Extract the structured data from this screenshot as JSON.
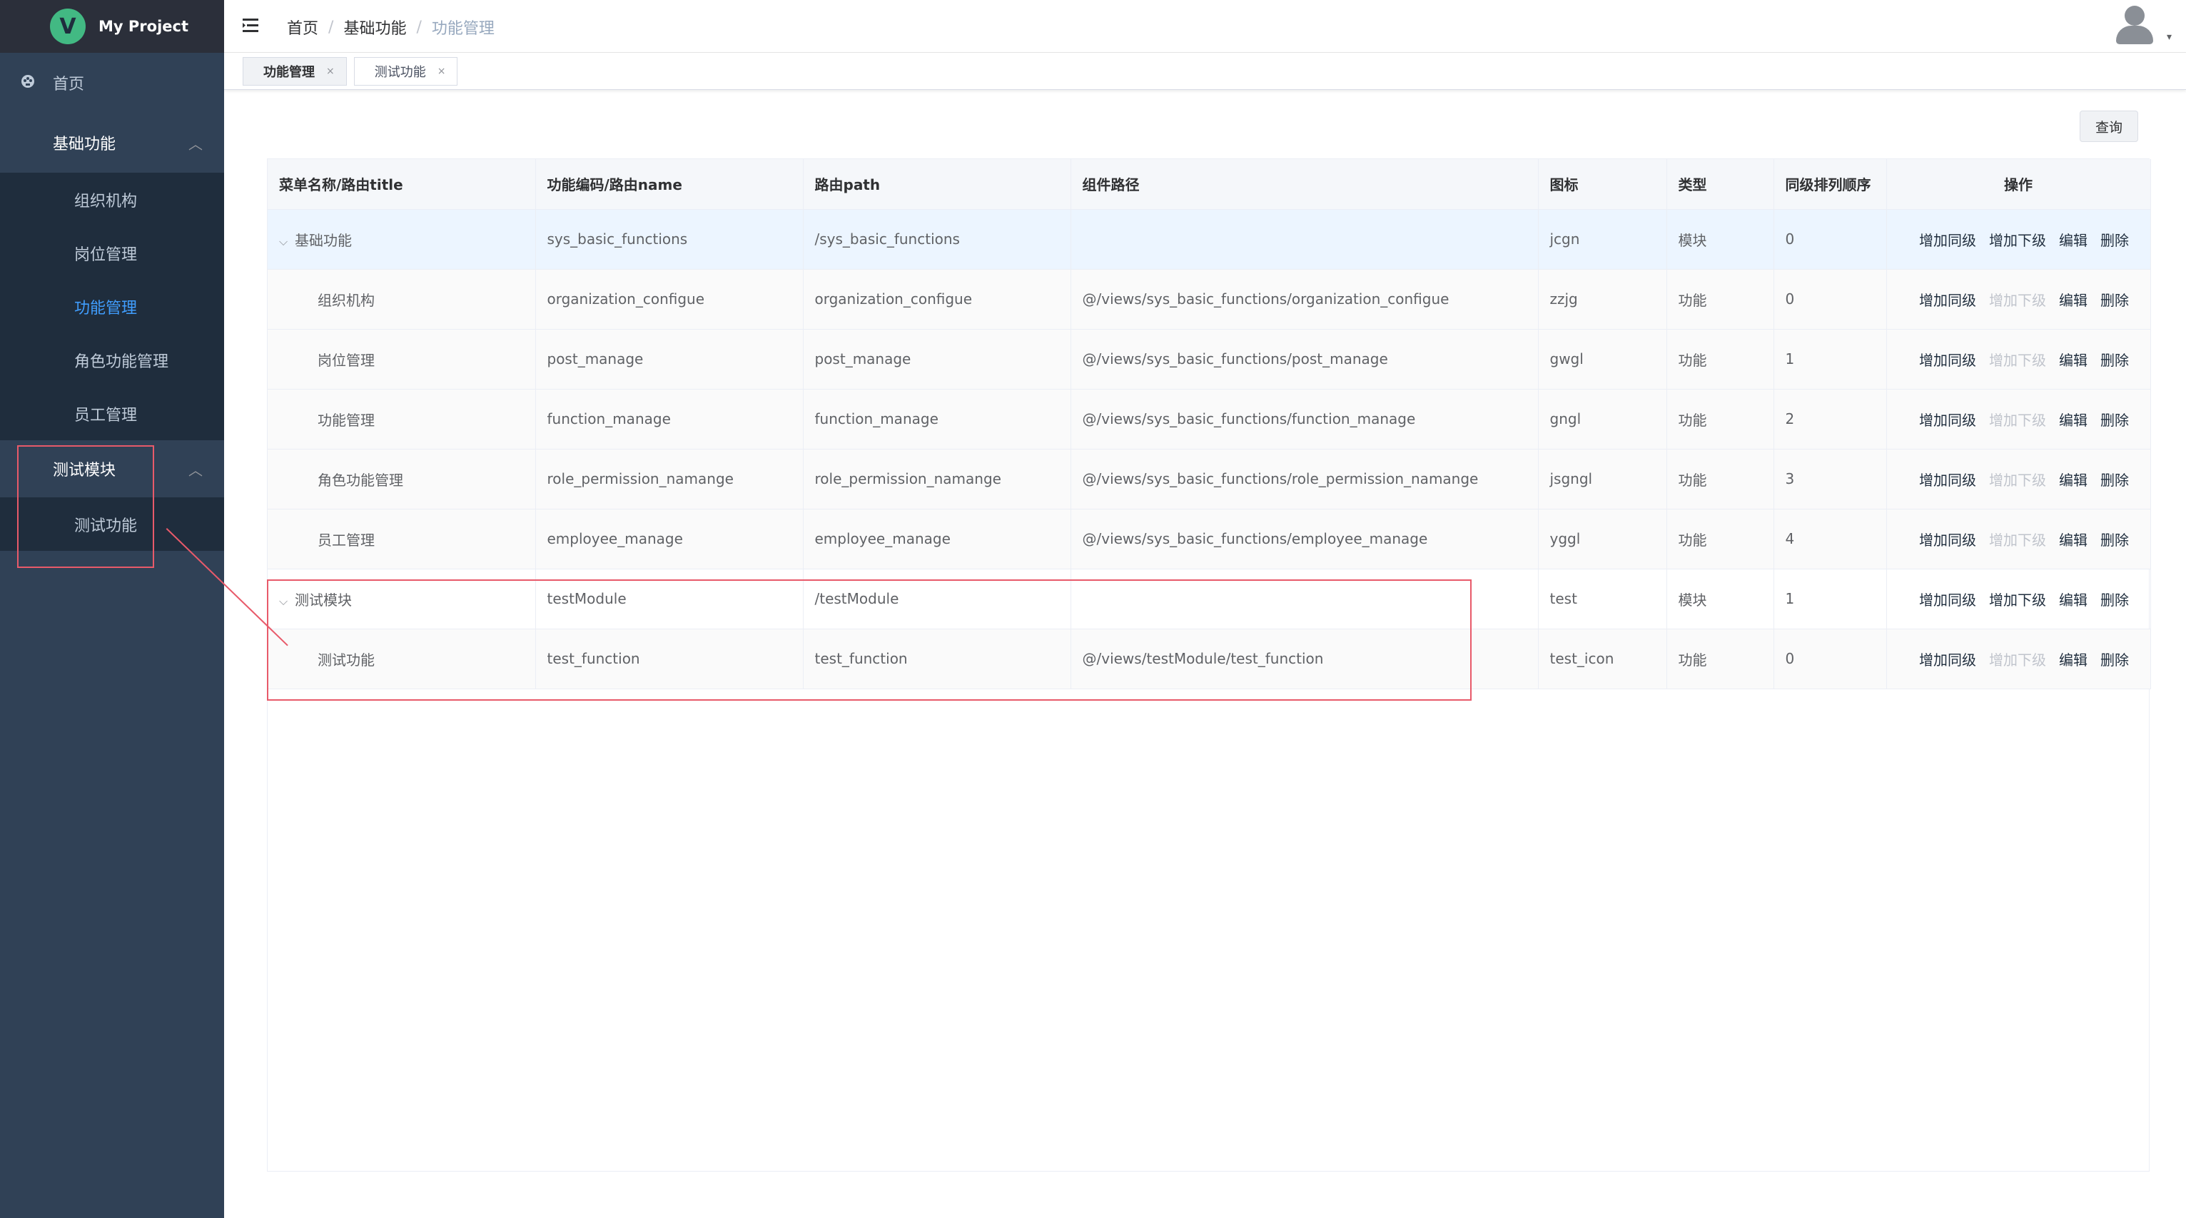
{
  "app": {
    "title": "My Project",
    "logo_letter": "V"
  },
  "sidebar": {
    "home": {
      "label": "首页",
      "icon": "dashboard-icon"
    },
    "groups": [
      {
        "label": "基础功能",
        "items": [
          {
            "label": "组织机构"
          },
          {
            "label": "岗位管理"
          },
          {
            "label": "功能管理",
            "active": true
          },
          {
            "label": "角色功能管理"
          },
          {
            "label": "员工管理"
          }
        ]
      },
      {
        "label": "测试模块",
        "items": [
          {
            "label": "测试功能"
          }
        ]
      }
    ]
  },
  "breadcrumb": [
    "首页",
    "基础功能",
    "功能管理"
  ],
  "tags": [
    {
      "label": "功能管理",
      "active": true,
      "close": "×"
    },
    {
      "label": "测试功能",
      "active": false,
      "close": "×"
    }
  ],
  "toolbar": {
    "query_label": "查询"
  },
  "table": {
    "columns": [
      "菜单名称/路由title",
      "功能编码/路由name",
      "路由path",
      "组件路径",
      "图标",
      "类型",
      "同级排列顺序",
      "操作"
    ],
    "actions": {
      "add_sibling": "增加同级",
      "add_child": "增加下级",
      "edit": "编辑",
      "delete": "删除"
    },
    "rows": [
      {
        "title": "基础功能",
        "name": "sys_basic_functions",
        "path": "/sys_basic_functions",
        "component": "",
        "icon": "jcgn",
        "type": "模块",
        "order": "0",
        "level": 0
      },
      {
        "title": "组织机构",
        "name": "organization_configue",
        "path": "organization_configue",
        "component": "@/views/sys_basic_functions/organization_configue",
        "icon": "zzjg",
        "type": "功能",
        "order": "0",
        "level": 1
      },
      {
        "title": "岗位管理",
        "name": "post_manage",
        "path": "post_manage",
        "component": "@/views/sys_basic_functions/post_manage",
        "icon": "gwgl",
        "type": "功能",
        "order": "1",
        "level": 1
      },
      {
        "title": "功能管理",
        "name": "function_manage",
        "path": "function_manage",
        "component": "@/views/sys_basic_functions/function_manage",
        "icon": "gngl",
        "type": "功能",
        "order": "2",
        "level": 1
      },
      {
        "title": "角色功能管理",
        "name": "role_permission_namange",
        "path": "role_permission_namange",
        "component": "@/views/sys_basic_functions/role_permission_namange",
        "icon": "jsgngl",
        "type": "功能",
        "order": "3",
        "level": 1
      },
      {
        "title": "员工管理",
        "name": "employee_manage",
        "path": "employee_manage",
        "component": "@/views/sys_basic_functions/employee_manage",
        "icon": "yggl",
        "type": "功能",
        "order": "4",
        "level": 1
      },
      {
        "title": "测试模块",
        "name": "testModule",
        "path": "/testModule",
        "component": "",
        "icon": "test",
        "type": "模块",
        "order": "1",
        "level": 0
      },
      {
        "title": "测试功能",
        "name": "test_function",
        "path": "test_function",
        "component": "@/views/testModule/test_function",
        "icon": "test_icon",
        "type": "功能",
        "order": "0",
        "level": 1
      }
    ]
  },
  "colors": {
    "sidebar_bg": "#304156",
    "submenu_bg": "#1f2d3d",
    "active": "#409eff",
    "annotation": "#e85a6a"
  }
}
